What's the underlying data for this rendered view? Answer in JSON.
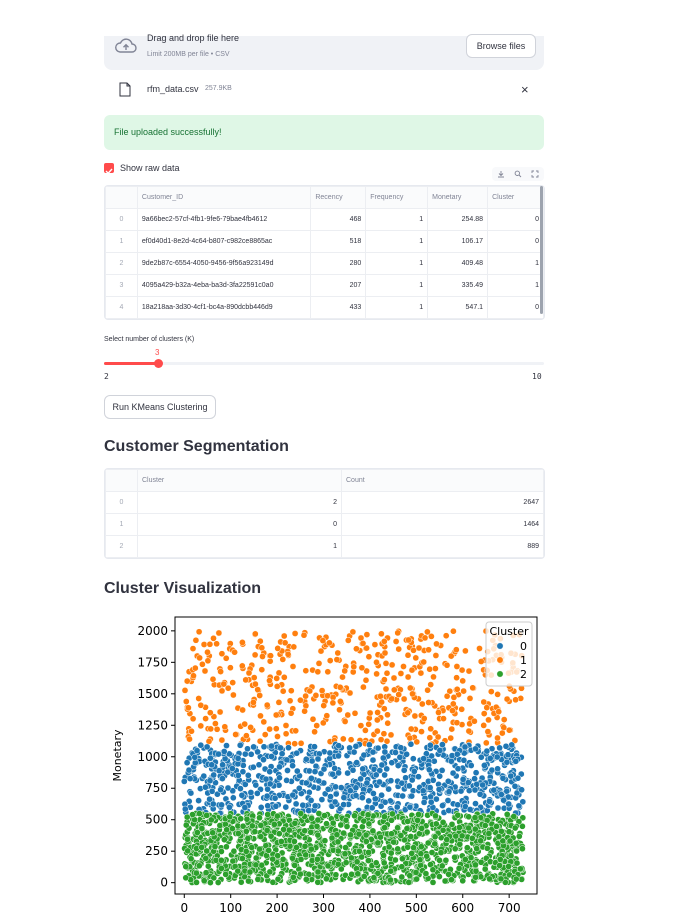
{
  "uploader": {
    "title": "Drag and drop file here",
    "limit": "Limit 200MB per file • CSV",
    "browse_label": "Browse files",
    "file_name": "rfm_data.csv",
    "file_size": "257.9KB",
    "close_glyph": "×"
  },
  "success": {
    "message": "File uploaded successfully!"
  },
  "raw": {
    "checkbox_label": "Show raw data",
    "toolbar_icons": [
      "download-icon",
      "search-icon",
      "fullscreen-icon"
    ],
    "columns": [
      "",
      "Customer_ID",
      "Recency",
      "Frequency",
      "Monetary",
      "Cluster"
    ],
    "rows": [
      [
        "0",
        "9a66bec2-57cf-4fb1-9fe6-79bae4fb4612",
        "468",
        "1",
        "254.88",
        "0"
      ],
      [
        "1",
        "ef0d40d1-8e2d-4c64-b807-c982ce8865ac",
        "518",
        "1",
        "106.17",
        "0"
      ],
      [
        "2",
        "9de2b87c-6554-4050-9456-9f56a923149d",
        "280",
        "1",
        "409.48",
        "1"
      ],
      [
        "3",
        "4095a429-b32a-4eba-ba3d-3fa22591c0a0",
        "207",
        "1",
        "335.49",
        "1"
      ],
      [
        "4",
        "18a218aa-3d30-4cf1-bc4a-890dcbb446d9",
        "433",
        "1",
        "547.1",
        "0"
      ]
    ]
  },
  "slider": {
    "label": "Select number of clusters (K)",
    "value": "3",
    "min": "2",
    "max": "10"
  },
  "run_button": "Run KMeans Clustering",
  "segmentation": {
    "heading": "Customer Segmentation",
    "columns": [
      "",
      "Cluster",
      "Count"
    ],
    "rows": [
      [
        "0",
        "2",
        "2647"
      ],
      [
        "1",
        "0",
        "1464"
      ],
      [
        "2",
        "1",
        "889"
      ]
    ]
  },
  "visualization": {
    "heading": "Cluster Visualization"
  },
  "colors": {
    "accent": "#ff4b4b",
    "cluster0": "#1f77b4",
    "cluster1": "#ff7f0e",
    "cluster2": "#2ca02c"
  },
  "chart_data": {
    "type": "scatter",
    "title": "",
    "xlabel": "",
    "ylabel": "Monetary",
    "xlim": [
      -20,
      760
    ],
    "ylim": [
      -90,
      2110
    ],
    "xticks": [
      0,
      100,
      200,
      300,
      400,
      500,
      600,
      700
    ],
    "yticks": [
      0,
      250,
      500,
      750,
      1000,
      1250,
      1500,
      1750,
      2000
    ],
    "grid": false,
    "legend": {
      "title": "Cluster",
      "placement": "top-right"
    },
    "series": [
      {
        "name": "0",
        "color": "#1f77b4",
        "x_range": [
          0,
          730
        ],
        "y_range": [
          550,
          1100
        ],
        "count": 1464
      },
      {
        "name": "1",
        "color": "#ff7f0e",
        "x_range": [
          0,
          730
        ],
        "y_range": [
          1100,
          2000
        ],
        "count": 889
      },
      {
        "name": "2",
        "color": "#2ca02c",
        "x_range": [
          0,
          730
        ],
        "y_range": [
          0,
          550
        ],
        "count": 2647
      }
    ]
  }
}
